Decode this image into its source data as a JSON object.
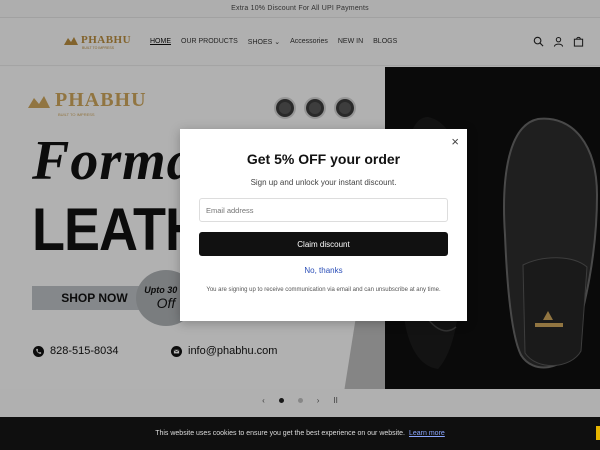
{
  "announcement": "Extra 10% Discount For All UPI Payments",
  "header": {
    "logo_text": "PHABHU",
    "logo_tagline": "BUILT TO IMPRESS",
    "nav": [
      {
        "label": "HOME",
        "active": true
      },
      {
        "label": "OUR PRODUCTS",
        "active": false
      },
      {
        "label": "SHOES",
        "active": false,
        "has_dropdown": true
      },
      {
        "label": "Accessories",
        "active": false
      },
      {
        "label": "NEW IN",
        "active": false
      },
      {
        "label": "BLOGS",
        "active": false
      }
    ],
    "icons": [
      "search-icon",
      "account-icon",
      "cart-icon"
    ]
  },
  "hero": {
    "logo_text": "PHABHU",
    "logo_tagline": "BUILT TO IMPRESS",
    "headline_1": "Formal",
    "headline_2": "LEATHER",
    "cta": "SHOP NOW",
    "offer_line1": "Upto 30 %",
    "offer_line2": "Off",
    "phone": "828-515-8034",
    "email": "info@phabhu.com",
    "colors": {
      "gold": "#c9a25a",
      "dark": "#0e0e0e"
    }
  },
  "slider": {
    "prev": "‹",
    "next": "›",
    "pause": "II",
    "slides": 2,
    "active_index": 0
  },
  "popup": {
    "title": "Get 5% OFF your order",
    "subtitle": "Sign up and unlock your instant discount.",
    "email_placeholder": "Email address",
    "claim_button": "Claim discount",
    "no_thanks": "No, thanks",
    "fine_print": "You are signing up to receive communication via email and can unsubscribe at any time.",
    "close": "×"
  },
  "cookie_bar": {
    "text": "This website uses cookies to ensure you get the best experience on our website.",
    "link": "Learn more"
  }
}
